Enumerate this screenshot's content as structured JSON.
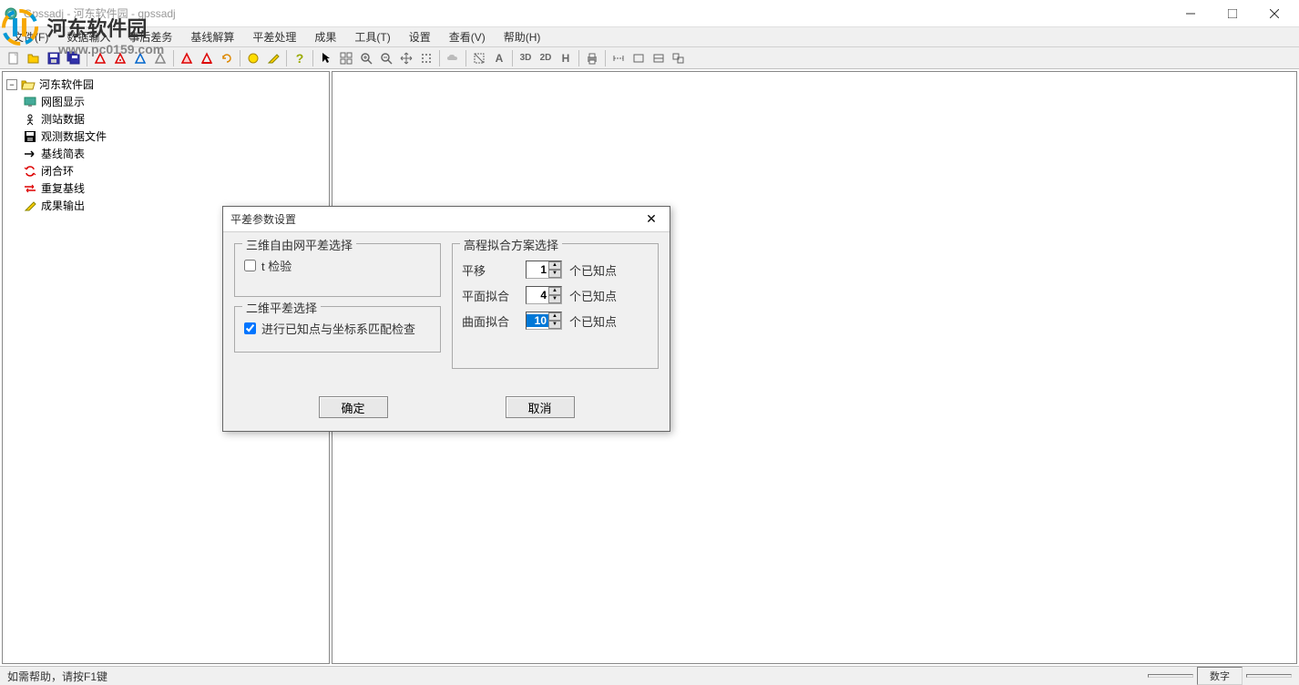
{
  "titlebar": {
    "text": "Gpssadj - 河东软件园 - gpssadj"
  },
  "watermark": {
    "text": "河东软件园",
    "url": "www.pc0159.com"
  },
  "menu": {
    "items": [
      "文件(F)",
      "数据输入",
      "事后差务",
      "基线解算",
      "平差处理",
      "成果",
      "工具(T)",
      "设置",
      "查看(V)",
      "帮助(H)"
    ]
  },
  "tree": {
    "root": "河东软件园",
    "items": [
      {
        "icon": "display-icon",
        "label": "网图显示"
      },
      {
        "icon": "station-icon",
        "label": "测站数据"
      },
      {
        "icon": "disk-icon",
        "label": "观测数据文件"
      },
      {
        "icon": "arrow-icon",
        "label": "基线简表"
      },
      {
        "icon": "loop-icon",
        "label": "闭合环"
      },
      {
        "icon": "repeat-icon",
        "label": "重复基线"
      },
      {
        "icon": "output-icon",
        "label": "成果输出"
      }
    ]
  },
  "dialog": {
    "title": "平差参数设置",
    "group1": {
      "title": "三维自由网平差选择",
      "check1": "t 检验"
    },
    "group2": {
      "title": "二维平差选择",
      "check1": "进行已知点与坐标系匹配检查"
    },
    "group3": {
      "title": "高程拟合方案选择",
      "rows": [
        {
          "label": "平移",
          "value": "1",
          "suffix": "个已知点"
        },
        {
          "label": "平面拟合",
          "value": "4",
          "suffix": "个已知点"
        },
        {
          "label": "曲面拟合",
          "value": "10",
          "suffix": "个已知点"
        }
      ]
    },
    "ok": "确定",
    "cancel": "取消"
  },
  "statusbar": {
    "help": "如需帮助，请按F1键",
    "num": "数字"
  },
  "toolbar_labels": {
    "3d": "3D",
    "2d": "2D",
    "h": "H",
    "a": "A"
  }
}
